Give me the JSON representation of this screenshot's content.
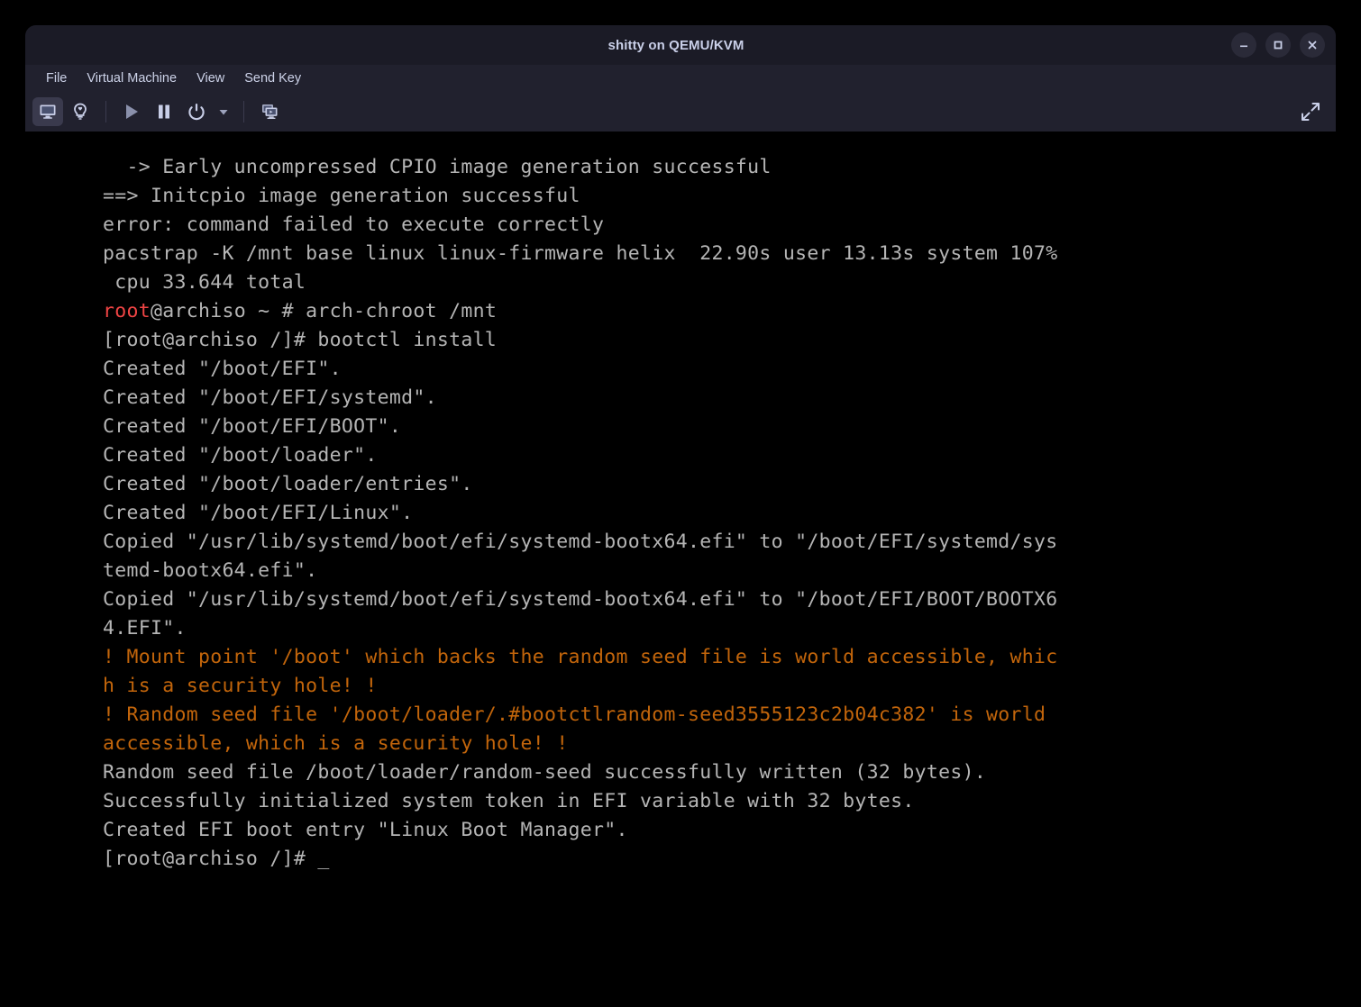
{
  "window": {
    "title": "shitty on QEMU/KVM",
    "controls": [
      {
        "name": "minimize-button",
        "icon": "minimize-icon"
      },
      {
        "name": "maximize-button",
        "icon": "maximize-icon"
      },
      {
        "name": "close-button",
        "icon": "close-icon"
      }
    ]
  },
  "menubar": {
    "items": [
      {
        "label": "File"
      },
      {
        "label": "Virtual Machine"
      },
      {
        "label": "View"
      },
      {
        "label": "Send Key"
      }
    ]
  },
  "toolbar": {
    "buttons": [
      {
        "name": "show-console-button",
        "icon": "monitor-icon",
        "pressed": true
      },
      {
        "name": "show-hardware-details-button",
        "icon": "lightbulb-icon",
        "pressed": false
      },
      {
        "name": "run-button",
        "icon": "play-icon",
        "pressed": false
      },
      {
        "name": "pause-button",
        "icon": "pause-icon",
        "pressed": false
      },
      {
        "name": "shutdown-button",
        "icon": "power-icon",
        "pressed": false
      },
      {
        "name": "shutdown-options-button",
        "icon": "chevron-down-icon",
        "pressed": false
      },
      {
        "name": "snapshots-button",
        "icon": "snapshot-icon",
        "pressed": false
      }
    ],
    "fullscreen": {
      "name": "fullscreen-button",
      "icon": "expand-arrows-icon"
    }
  },
  "colors": {
    "accent_red": "#ef4444",
    "warning_orange": "#c2650b",
    "terminal_fg": "#b5b5b5",
    "terminal_bg": "#000000",
    "chrome_bg": "#21212e",
    "titlebar_bg": "#1b1b26"
  },
  "terminal": {
    "lines": [
      {
        "text": "  -> Early uncompressed CPIO image generation successful",
        "color": "gray"
      },
      {
        "text": "==> Initcpio image generation successful",
        "color": "gray"
      },
      {
        "text": "error: command failed to execute correctly",
        "color": "gray"
      },
      {
        "text": "pacstrap -K /mnt base linux linux-firmware helix  22.90s user 13.13s system 107%",
        "color": "gray"
      },
      {
        "text": " cpu 33.644 total",
        "color": "gray"
      },
      {
        "text": "",
        "color": "prompt-root",
        "segments": [
          {
            "text": "root",
            "color": "red"
          },
          {
            "text": "@archiso ~ # arch-chroot /mnt",
            "color": "gray"
          }
        ]
      },
      {
        "text": "[root@archiso /]# bootctl install",
        "color": "gray"
      },
      {
        "text": "Created \"/boot/EFI\".",
        "color": "gray"
      },
      {
        "text": "Created \"/boot/EFI/systemd\".",
        "color": "gray"
      },
      {
        "text": "Created \"/boot/EFI/BOOT\".",
        "color": "gray"
      },
      {
        "text": "Created \"/boot/loader\".",
        "color": "gray"
      },
      {
        "text": "Created \"/boot/loader/entries\".",
        "color": "gray"
      },
      {
        "text": "Created \"/boot/EFI/Linux\".",
        "color": "gray"
      },
      {
        "text": "Copied \"/usr/lib/systemd/boot/efi/systemd-bootx64.efi\" to \"/boot/EFI/systemd/sys",
        "color": "gray"
      },
      {
        "text": "temd-bootx64.efi\".",
        "color": "gray"
      },
      {
        "text": "Copied \"/usr/lib/systemd/boot/efi/systemd-bootx64.efi\" to \"/boot/EFI/BOOT/BOOTX6",
        "color": "gray"
      },
      {
        "text": "4.EFI\".",
        "color": "gray"
      },
      {
        "text": "! Mount point '/boot' which backs the random seed file is world accessible, whic",
        "color": "orange"
      },
      {
        "text": "h is a security hole! !",
        "color": "orange"
      },
      {
        "text": "! Random seed file '/boot/loader/.#bootctlrandom-seed3555123c2b04c382' is world",
        "color": "orange"
      },
      {
        "text": "accessible, which is a security hole! !",
        "color": "orange"
      },
      {
        "text": "Random seed file /boot/loader/random-seed successfully written (32 bytes).",
        "color": "gray"
      },
      {
        "text": "Successfully initialized system token in EFI variable with 32 bytes.",
        "color": "gray"
      },
      {
        "text": "Created EFI boot entry \"Linux Boot Manager\".",
        "color": "gray"
      },
      {
        "text": "[root@archiso /]# _",
        "color": "gray"
      }
    ]
  }
}
